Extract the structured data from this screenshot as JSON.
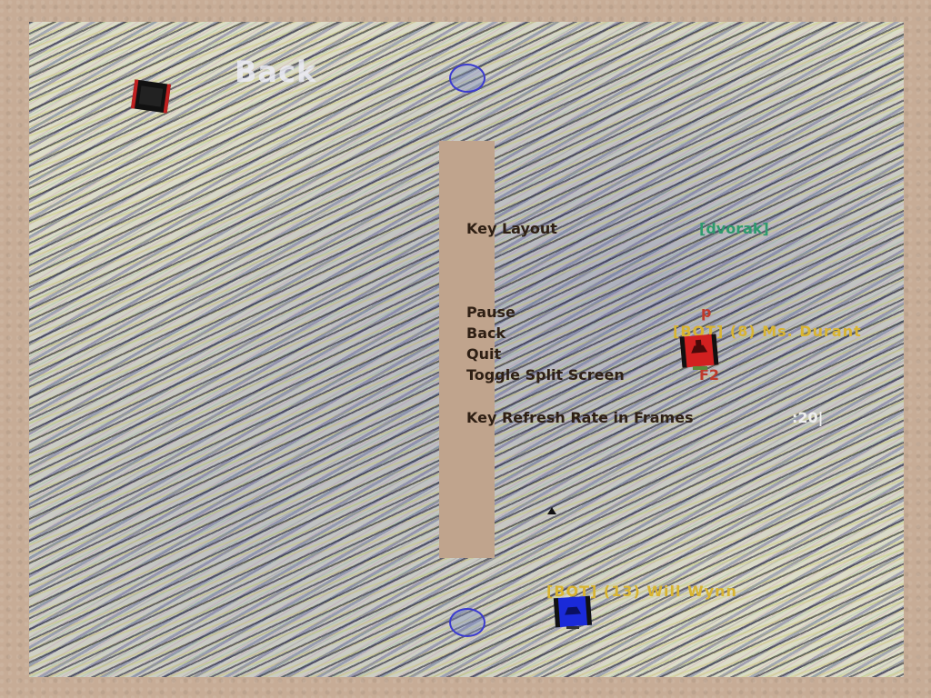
{
  "menu": {
    "back_title": "Back",
    "key_layout_label": "Key Layout",
    "key_layout_value": "[dvorak]",
    "bindings": [
      {
        "label": "Pause",
        "key": "p"
      },
      {
        "label": "Back",
        "key": ""
      },
      {
        "label": "Quit",
        "key": ""
      },
      {
        "label": "Toggle Split Screen",
        "key": "F2"
      }
    ],
    "refresh_label": "Key Refresh Rate in Frames",
    "refresh_value": ":20|"
  },
  "bots": {
    "bot1_name": "[BOT] (8) Ms. Durant",
    "bot2_name": "[BOT] (13) Will Wynn"
  },
  "colors": {
    "frame": "#c7ac96",
    "label_text": "#2e1f14",
    "layout_value": "#2e9a6e",
    "key_value": "#c0392b",
    "bot_name": "#d9b430"
  }
}
